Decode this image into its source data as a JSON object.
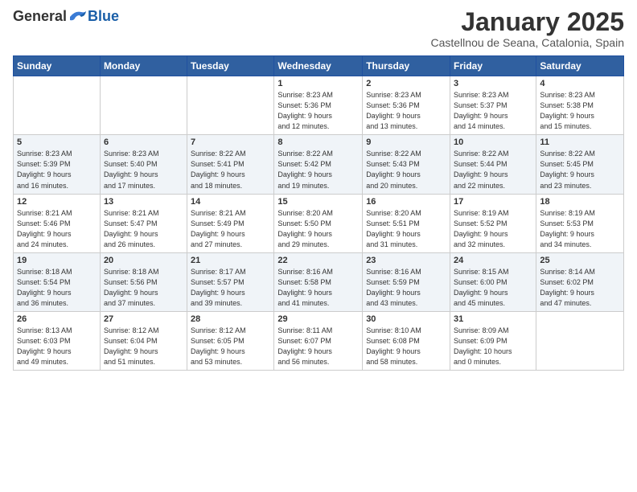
{
  "logo": {
    "general": "General",
    "blue": "Blue"
  },
  "header": {
    "month": "January 2025",
    "location": "Castellnou de Seana, Catalonia, Spain"
  },
  "weekdays": [
    "Sunday",
    "Monday",
    "Tuesday",
    "Wednesday",
    "Thursday",
    "Friday",
    "Saturday"
  ],
  "weeks": [
    [
      {
        "day": "",
        "info": ""
      },
      {
        "day": "",
        "info": ""
      },
      {
        "day": "",
        "info": ""
      },
      {
        "day": "1",
        "info": "Sunrise: 8:23 AM\nSunset: 5:36 PM\nDaylight: 9 hours\nand 12 minutes."
      },
      {
        "day": "2",
        "info": "Sunrise: 8:23 AM\nSunset: 5:36 PM\nDaylight: 9 hours\nand 13 minutes."
      },
      {
        "day": "3",
        "info": "Sunrise: 8:23 AM\nSunset: 5:37 PM\nDaylight: 9 hours\nand 14 minutes."
      },
      {
        "day": "4",
        "info": "Sunrise: 8:23 AM\nSunset: 5:38 PM\nDaylight: 9 hours\nand 15 minutes."
      }
    ],
    [
      {
        "day": "5",
        "info": "Sunrise: 8:23 AM\nSunset: 5:39 PM\nDaylight: 9 hours\nand 16 minutes."
      },
      {
        "day": "6",
        "info": "Sunrise: 8:23 AM\nSunset: 5:40 PM\nDaylight: 9 hours\nand 17 minutes."
      },
      {
        "day": "7",
        "info": "Sunrise: 8:22 AM\nSunset: 5:41 PM\nDaylight: 9 hours\nand 18 minutes."
      },
      {
        "day": "8",
        "info": "Sunrise: 8:22 AM\nSunset: 5:42 PM\nDaylight: 9 hours\nand 19 minutes."
      },
      {
        "day": "9",
        "info": "Sunrise: 8:22 AM\nSunset: 5:43 PM\nDaylight: 9 hours\nand 20 minutes."
      },
      {
        "day": "10",
        "info": "Sunrise: 8:22 AM\nSunset: 5:44 PM\nDaylight: 9 hours\nand 22 minutes."
      },
      {
        "day": "11",
        "info": "Sunrise: 8:22 AM\nSunset: 5:45 PM\nDaylight: 9 hours\nand 23 minutes."
      }
    ],
    [
      {
        "day": "12",
        "info": "Sunrise: 8:21 AM\nSunset: 5:46 PM\nDaylight: 9 hours\nand 24 minutes."
      },
      {
        "day": "13",
        "info": "Sunrise: 8:21 AM\nSunset: 5:47 PM\nDaylight: 9 hours\nand 26 minutes."
      },
      {
        "day": "14",
        "info": "Sunrise: 8:21 AM\nSunset: 5:49 PM\nDaylight: 9 hours\nand 27 minutes."
      },
      {
        "day": "15",
        "info": "Sunrise: 8:20 AM\nSunset: 5:50 PM\nDaylight: 9 hours\nand 29 minutes."
      },
      {
        "day": "16",
        "info": "Sunrise: 8:20 AM\nSunset: 5:51 PM\nDaylight: 9 hours\nand 31 minutes."
      },
      {
        "day": "17",
        "info": "Sunrise: 8:19 AM\nSunset: 5:52 PM\nDaylight: 9 hours\nand 32 minutes."
      },
      {
        "day": "18",
        "info": "Sunrise: 8:19 AM\nSunset: 5:53 PM\nDaylight: 9 hours\nand 34 minutes."
      }
    ],
    [
      {
        "day": "19",
        "info": "Sunrise: 8:18 AM\nSunset: 5:54 PM\nDaylight: 9 hours\nand 36 minutes."
      },
      {
        "day": "20",
        "info": "Sunrise: 8:18 AM\nSunset: 5:56 PM\nDaylight: 9 hours\nand 37 minutes."
      },
      {
        "day": "21",
        "info": "Sunrise: 8:17 AM\nSunset: 5:57 PM\nDaylight: 9 hours\nand 39 minutes."
      },
      {
        "day": "22",
        "info": "Sunrise: 8:16 AM\nSunset: 5:58 PM\nDaylight: 9 hours\nand 41 minutes."
      },
      {
        "day": "23",
        "info": "Sunrise: 8:16 AM\nSunset: 5:59 PM\nDaylight: 9 hours\nand 43 minutes."
      },
      {
        "day": "24",
        "info": "Sunrise: 8:15 AM\nSunset: 6:00 PM\nDaylight: 9 hours\nand 45 minutes."
      },
      {
        "day": "25",
        "info": "Sunrise: 8:14 AM\nSunset: 6:02 PM\nDaylight: 9 hours\nand 47 minutes."
      }
    ],
    [
      {
        "day": "26",
        "info": "Sunrise: 8:13 AM\nSunset: 6:03 PM\nDaylight: 9 hours\nand 49 minutes."
      },
      {
        "day": "27",
        "info": "Sunrise: 8:12 AM\nSunset: 6:04 PM\nDaylight: 9 hours\nand 51 minutes."
      },
      {
        "day": "28",
        "info": "Sunrise: 8:12 AM\nSunset: 6:05 PM\nDaylight: 9 hours\nand 53 minutes."
      },
      {
        "day": "29",
        "info": "Sunrise: 8:11 AM\nSunset: 6:07 PM\nDaylight: 9 hours\nand 56 minutes."
      },
      {
        "day": "30",
        "info": "Sunrise: 8:10 AM\nSunset: 6:08 PM\nDaylight: 9 hours\nand 58 minutes."
      },
      {
        "day": "31",
        "info": "Sunrise: 8:09 AM\nSunset: 6:09 PM\nDaylight: 10 hours\nand 0 minutes."
      },
      {
        "day": "",
        "info": ""
      }
    ]
  ]
}
